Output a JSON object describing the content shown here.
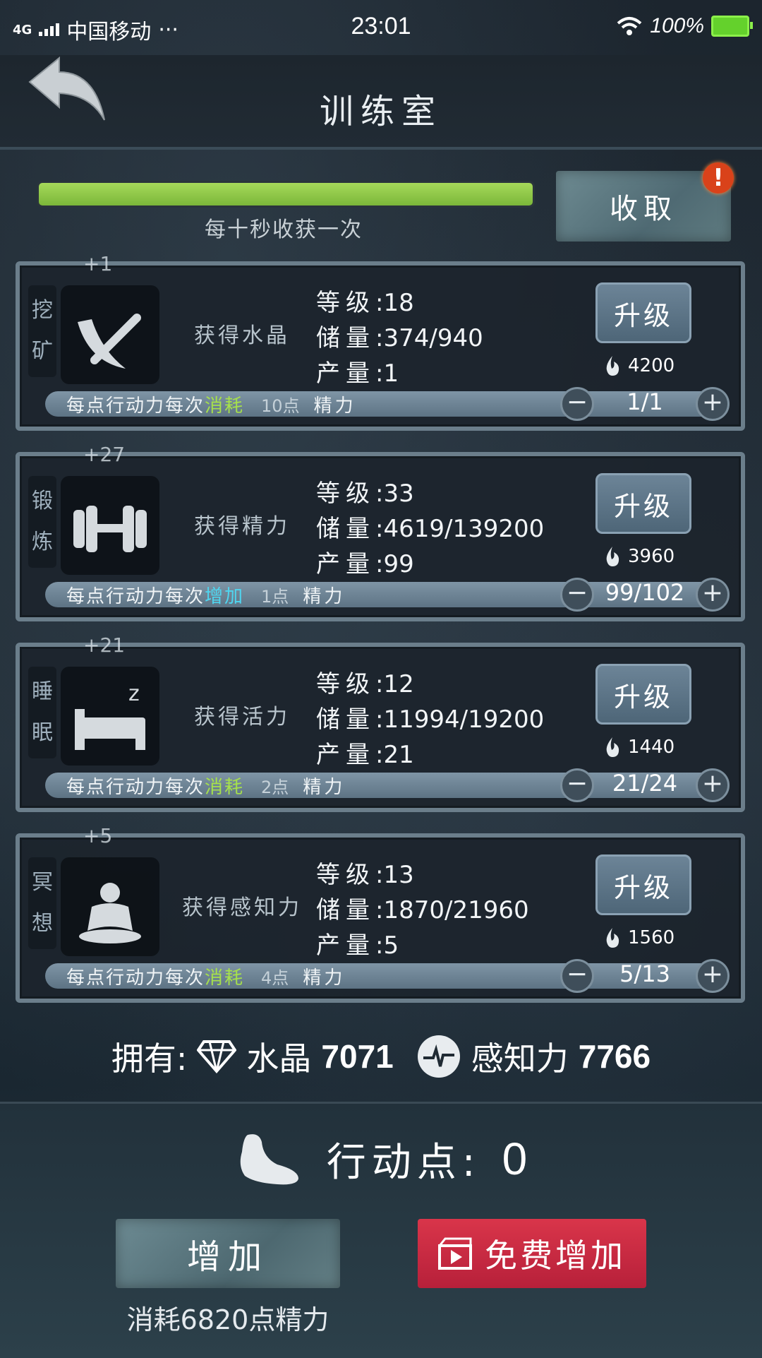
{
  "status_bar": {
    "network": "4G",
    "carrier": "中国移动",
    "dots": "···",
    "time": "23:01",
    "battery": "100%"
  },
  "header": {
    "title": "训练室"
  },
  "progress": {
    "fill_fraction": 1.0,
    "label": "每十秒收获一次"
  },
  "collect_button": {
    "label": "收取",
    "badge": "!"
  },
  "cards": [
    {
      "side_label_1": "挖",
      "side_label_2": "矿",
      "float_text": "+1",
      "gain": "获得水晶",
      "level_key": "等级",
      "level": "18",
      "storage_key": "储量",
      "storage": "374/940",
      "output_key": "产量",
      "output": "1",
      "upgrade": "升级",
      "cost": "4200",
      "bar_prefix": "每点行动力每次",
      "bar_action": "消耗",
      "bar_action_color": "#a6e04c",
      "bar_points": "10点",
      "bar_resource": "精力",
      "count": "1/1",
      "icon": "pickaxe-icon"
    },
    {
      "side_label_1": "锻",
      "side_label_2": "炼",
      "float_text": "+27",
      "gain": "获得精力",
      "level_key": "等级",
      "level": "33",
      "storage_key": "储量",
      "storage": "4619/139200",
      "output_key": "产量",
      "output": "99",
      "upgrade": "升级",
      "cost": "3960",
      "bar_prefix": "每点行动力每次",
      "bar_action": "增加",
      "bar_action_color": "#4fd6f0",
      "bar_points": "1点",
      "bar_resource": "精力",
      "count": "99/102",
      "icon": "dumbbell-icon"
    },
    {
      "side_label_1": "睡",
      "side_label_2": "眠",
      "float_text": "+21",
      "gain": "获得活力",
      "level_key": "等级",
      "level": "12",
      "storage_key": "储量",
      "storage": "11994/19200",
      "output_key": "产量",
      "output": "21",
      "upgrade": "升级",
      "cost": "1440",
      "bar_prefix": "每点行动力每次",
      "bar_action": "消耗",
      "bar_action_color": "#a6e04c",
      "bar_points": "2点",
      "bar_resource": "精力",
      "count": "21/24",
      "icon": "bed-icon"
    },
    {
      "side_label_1": "冥",
      "side_label_2": "想",
      "float_text": "+5",
      "gain": "获得感知力",
      "level_key": "等级",
      "level": "13",
      "storage_key": "储量",
      "storage": "1870/21960",
      "output_key": "产量",
      "output": "5",
      "upgrade": "升级",
      "cost": "1560",
      "bar_prefix": "每点行动力每次",
      "bar_action": "消耗",
      "bar_action_color": "#a6e04c",
      "bar_points": "4点",
      "bar_resource": "精力",
      "count": "5/13",
      "icon": "meditation-icon"
    }
  ],
  "resources": {
    "label": "拥有:",
    "crystal_label": "水晶",
    "crystal_value": "7071",
    "perception_label": "感知力",
    "perception_value": "7766"
  },
  "action_points": {
    "label": "行动点:",
    "value": "0"
  },
  "add_button": {
    "label": "增加",
    "cost_note": "消耗6820点精力"
  },
  "free_button": {
    "label": "免费增加"
  }
}
